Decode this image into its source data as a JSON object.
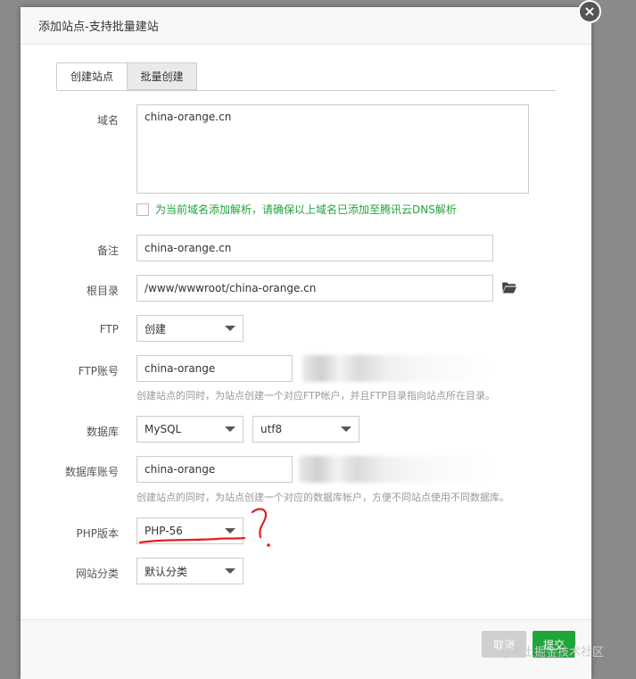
{
  "dialog": {
    "title": "添加站点-支持批量建站",
    "close_symbol": "×"
  },
  "tabs": [
    {
      "label": "创建站点",
      "active": true
    },
    {
      "label": "批量创建",
      "active": false
    }
  ],
  "form": {
    "domain": {
      "label": "域名",
      "value": "china-orange.cn"
    },
    "dns_checkbox": {
      "label": "为当前域名添加解析，请确保以上域名已添加至腾讯云DNS解析",
      "checked": false
    },
    "remark": {
      "label": "备注",
      "value": "china-orange.cn"
    },
    "root": {
      "label": "根目录",
      "value": "/www/wwwroot/china-orange.cn",
      "icon": "folder-icon"
    },
    "ftp": {
      "label": "FTP",
      "selected": "创建"
    },
    "ftp_account": {
      "label": "FTP账号",
      "value": "china-orange",
      "hint": "创建站点的同时，为站点创建一个对应FTP帐户，并且FTP目录指向站点所在目录。"
    },
    "database": {
      "label": "数据库",
      "type": "MySQL",
      "charset": "utf8"
    },
    "db_account": {
      "label": "数据库账号",
      "value": "china-orange",
      "hint": "创建站点的同时，为站点创建一个对应的数据库帐户，方便不同站点使用不同数据库。"
    },
    "php": {
      "label": "PHP版本",
      "selected": "PHP-56"
    },
    "category": {
      "label": "网站分类",
      "selected": "默认分类"
    }
  },
  "footer": {
    "cancel_label": "取消",
    "submit_label": "提交"
  },
  "watermark": "@稀土掘金技术社区",
  "colors": {
    "accent_green": "#20a53a",
    "annotation_red": "#e02020"
  }
}
